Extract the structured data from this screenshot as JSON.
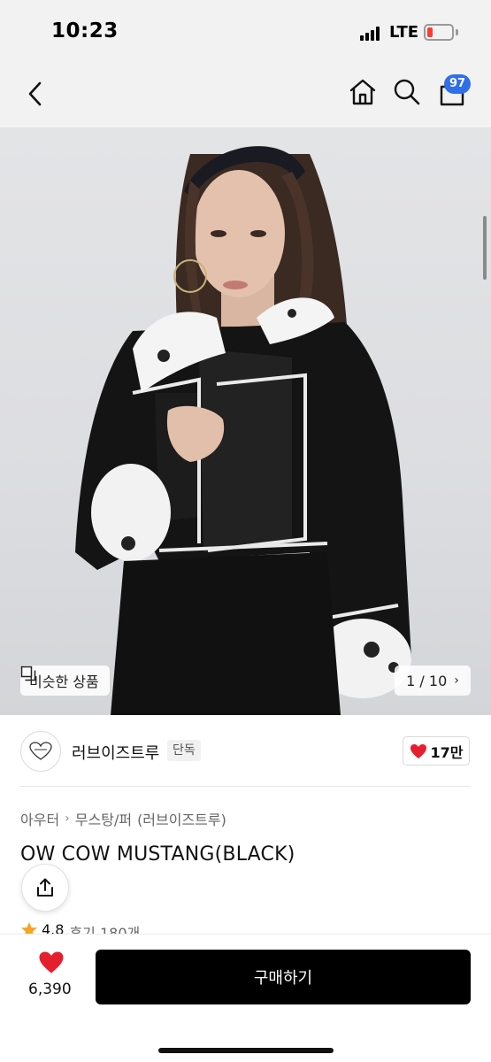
{
  "status_bar": {
    "time": "10:23",
    "network": "LTE"
  },
  "nav": {
    "back_icon": "chevron-left-icon",
    "home_icon": "home-icon",
    "search_icon": "search-icon",
    "cart_icon": "bag-icon",
    "cart_badge": "97"
  },
  "hero": {
    "similar_label": "비슷한 상품",
    "page_counter": "1 / 10"
  },
  "brand": {
    "name": "러브이즈트루",
    "tag": "단독",
    "likes": "17만"
  },
  "product": {
    "breadcrumb": [
      "아우터",
      "무스탕/퍼",
      "(러브이즈트루)"
    ],
    "title": "OW COW MUSTANG(BLACK)",
    "rating": "4.8",
    "reviews": "후기 180개"
  },
  "bottom_bar": {
    "wish_count": "6,390",
    "buy_label": "구매하기"
  },
  "colors": {
    "accent_badge": "#2f6fe8",
    "heart": "#e5202e",
    "buy_button": "#000000",
    "star": "#f5a623"
  }
}
